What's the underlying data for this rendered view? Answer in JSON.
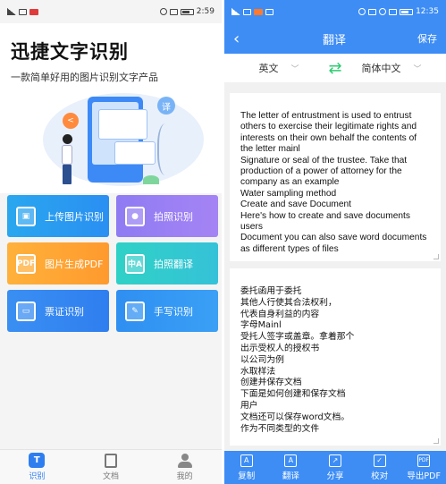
{
  "left": {
    "status": {
      "time": "2:59",
      "carrier": "ᵢ₆"
    },
    "app_title": "迅捷文字识别",
    "app_subtitle": "一款简单好用的图片识别文字产品",
    "illustration": {
      "translate_glyph": "译",
      "share_glyph": "<"
    },
    "tiles": [
      {
        "label": "上传图片识别",
        "icon": "image-upload-icon",
        "color": "#2a9cf0"
      },
      {
        "label": "拍照识别",
        "icon": "camera-icon",
        "color": "#9b80f3"
      },
      {
        "label": "图片生成PDF",
        "icon": "pdf-icon",
        "icon_text": "PDF",
        "color": "#ffa834"
      },
      {
        "label": "拍照翻译",
        "icon": "translate-camera-icon",
        "icon_text": "中A",
        "color": "#32c9cf"
      },
      {
        "label": "票证识别",
        "icon": "ticket-icon",
        "color": "#3589f1"
      },
      {
        "label": "手写识别",
        "icon": "pen-icon",
        "color": "#3497f3"
      }
    ],
    "tabs": [
      {
        "label": "识别",
        "icon": "recognize-icon",
        "icon_text": "T",
        "active": true
      },
      {
        "label": "文档",
        "icon": "document-icon",
        "active": false
      },
      {
        "label": "我的",
        "icon": "user-icon",
        "active": false
      }
    ]
  },
  "right": {
    "status": {
      "time": "12:35"
    },
    "nav": {
      "back": "‹",
      "title": "翻译",
      "save": "保存"
    },
    "lang": {
      "source": "英文",
      "target": "简体中文",
      "chev": "﹀",
      "swap": "⇄"
    },
    "source_lines": [
      "The letter of entrustment is used to entrust others to exercise their legitimate rights and interests on their own behalf the contents of the letter mainl",
      "Signature or seal of the trustee. Take that production of a power of attorney for the company as an example",
      "Water sampling method",
      "Create and save Document",
      "Here's how to create and save documents users",
      "Document you can also save word documents as different types of files"
    ],
    "target_lines": [
      "委托函用于委托",
      "其他人行使其合法权利，",
      "代表自身利益的内容",
      "字母Mainl",
      "受托人签字或盖章。拿着那个",
      "出示受权人的授权书",
      "以公司为例",
      "水取样法",
      "创建并保存文档",
      "下面是如何创建和保存文档",
      "用户",
      "文档还可以保存word文档。",
      "作为不同类型的文件"
    ],
    "tabs": [
      {
        "label": "复制",
        "icon": "copy-icon",
        "icon_text": "A"
      },
      {
        "label": "翻译",
        "icon": "translate-icon",
        "icon_text": "A"
      },
      {
        "label": "分享",
        "icon": "share-icon",
        "icon_text": "↗"
      },
      {
        "label": "校对",
        "icon": "proofread-icon",
        "icon_text": "✓"
      },
      {
        "label": "导出PDF",
        "icon": "export-pdf-icon",
        "icon_text": "PDF"
      }
    ]
  }
}
